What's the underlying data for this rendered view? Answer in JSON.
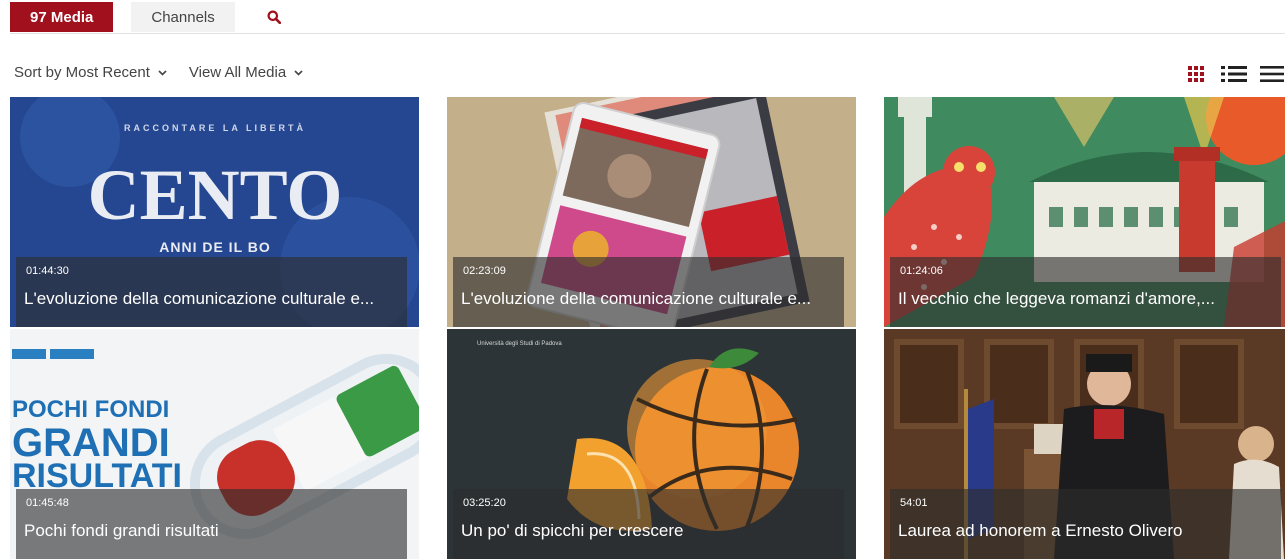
{
  "tabs": [
    {
      "label": "97 Media",
      "active": true
    },
    {
      "label": "Channels",
      "active": false
    }
  ],
  "toolbar": {
    "sort_label": "Sort by Most Recent",
    "filter_label": "View All Media"
  },
  "colors": {
    "accent": "#a0111d",
    "overlay": "#2d2d2d"
  },
  "icons": {
    "search": "search-icon",
    "views": [
      "grid-view-icon",
      "detailed-list-view-icon",
      "compact-list-view-icon"
    ]
  },
  "media": [
    {
      "duration": "01:44:30",
      "title": "L'evoluzione della comunicazione culturale e...",
      "thumb_text": {
        "top": "RACCONTARE LA LIBERTÀ",
        "main": "CENTO",
        "sub": "ANNI DE IL BO"
      }
    },
    {
      "duration": "02:23:09",
      "title": "L'evoluzione della comunicazione culturale e..."
    },
    {
      "duration": "01:24:06",
      "title": "Il vecchio che leggeva romanzi d'amore,..."
    },
    {
      "duration": "01:45:48",
      "title": "Pochi fondi grandi risultati",
      "thumb_text": {
        "l1": "POCHI FONDI",
        "l2": "GRANDI",
        "l3": "RISULTATI"
      }
    },
    {
      "duration": "03:25:20",
      "title": "Un po' di spicchi per crescere",
      "thumb_text": {
        "caption": "Università degli Studi di Padova"
      }
    },
    {
      "duration": "54:01",
      "title": "Laurea ad honorem a Ernesto Olivero"
    }
  ]
}
